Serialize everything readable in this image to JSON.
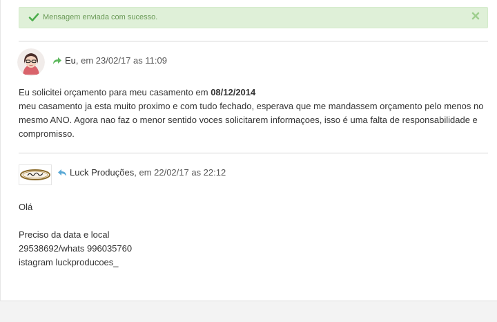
{
  "alert": {
    "message": "Mensagem enviada com sucesso.",
    "icon": "check-icon",
    "close_icon": "close-icon",
    "bg_color": "#dff0d8",
    "icon_color": "#4cae4c"
  },
  "messages": [
    {
      "author": "Eu",
      "meta_suffix": ", em 23/02/17 as 11:09",
      "direction_icon": "forward-arrow-icon",
      "direction_color": "#5cb85c",
      "line1_prefix": "Eu solicitei orçamento para meu casamento em ",
      "line1_date": "08/12/2014",
      "line2": "meu casamento ja esta muito proximo e com tudo fechado, esperava que me mandassem orçamento pelo menos no",
      "line3": "mesmo ANO. Agora nao faz o menor sentido voces solicitarem informaçoes, isso é uma falta de responsabilidade e",
      "line4": "compromisso."
    },
    {
      "author": "Luck Produções",
      "meta_suffix": ", em 22/02/17 as 22:12",
      "direction_icon": "reply-arrow-icon",
      "direction_color": "#5aa9d6",
      "greeting": "Olá",
      "line1": "Preciso da data e local",
      "line2": "29538692/whats 996035760",
      "line3": "istagram luckproducoes_"
    }
  ]
}
